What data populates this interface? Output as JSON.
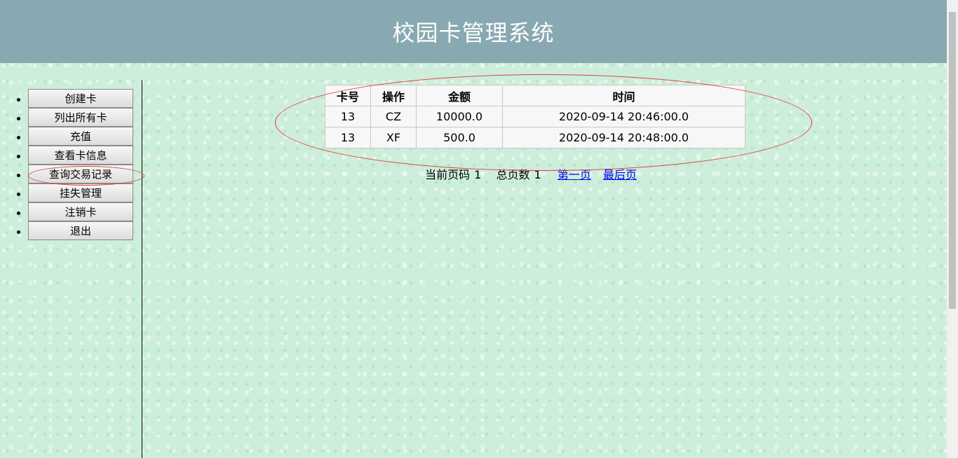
{
  "header": {
    "title": "校园卡管理系统"
  },
  "sidebar": {
    "items": [
      {
        "label": "创建卡"
      },
      {
        "label": "列出所有卡"
      },
      {
        "label": "充值"
      },
      {
        "label": "查看卡信息"
      },
      {
        "label": "查询交易记录"
      },
      {
        "label": "挂失管理"
      },
      {
        "label": "注销卡"
      },
      {
        "label": "退出"
      }
    ]
  },
  "records": {
    "columns": [
      "卡号",
      "操作",
      "金额",
      "时间"
    ],
    "rows": [
      [
        "13",
        "CZ",
        "10000.0",
        "2020-09-14 20:46:00.0"
      ],
      [
        "13",
        "XF",
        "500.0",
        "2020-09-14 20:48:00.0"
      ]
    ]
  },
  "pager": {
    "current_label": "当前页码",
    "current_page": "1",
    "total_label": "总页数",
    "total_pages": "1",
    "first_link": "第一页",
    "last_link": "最后页"
  },
  "colors": {
    "header_bg": "#88a9b1",
    "page_bg": "#cdeedb",
    "annotation": "#e23a3a",
    "link": "#0000ee"
  }
}
